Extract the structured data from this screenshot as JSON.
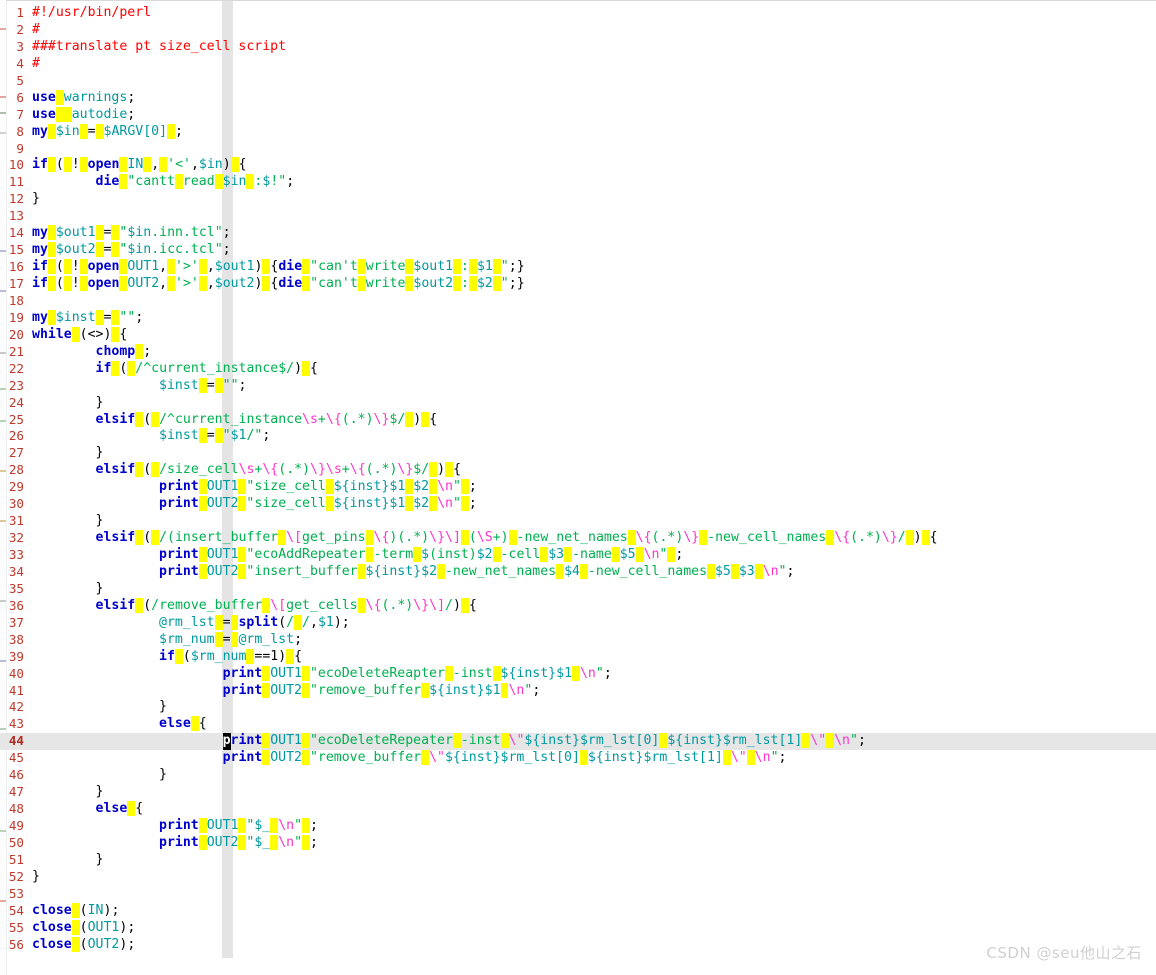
{
  "editor": {
    "language": "perl",
    "current_line": 44,
    "cursor_column": 1,
    "total_lines": 56,
    "colors": {
      "background": "#ffffff",
      "line_number": "#c0392b",
      "keyword": "#0000cc",
      "variable": "#0099a0",
      "string": "#00b050",
      "regex": "#00b050",
      "escape": "#ff33cc",
      "comment": "#ff0000",
      "whitespace_marker": "#ffff00",
      "current_line_highlight": "#e6e6e6",
      "column_guide": "#e4e4e4",
      "cursor": "#000000"
    },
    "lines": [
      {
        "n": 1,
        "text": "#!/usr/bin/perl"
      },
      {
        "n": 2,
        "text": "#"
      },
      {
        "n": 3,
        "text": "###translate pt size_cell script"
      },
      {
        "n": 4,
        "text": "#"
      },
      {
        "n": 5,
        "text": ""
      },
      {
        "n": 6,
        "text": "use warnings;"
      },
      {
        "n": 7,
        "text": "use  autodie;"
      },
      {
        "n": 8,
        "text": "my $in = $ARGV[0] ;"
      },
      {
        "n": 9,
        "text": ""
      },
      {
        "n": 10,
        "text": "if ( ! open IN , '<',$in) {"
      },
      {
        "n": 11,
        "text": "        die \"cantt read $in :$!\";"
      },
      {
        "n": 12,
        "text": "}"
      },
      {
        "n": 13,
        "text": ""
      },
      {
        "n": 14,
        "text": "my $out1 = \"$in.inn.tcl\";"
      },
      {
        "n": 15,
        "text": "my $out2 = \"$in.icc.tcl\";"
      },
      {
        "n": 16,
        "text": "if ( ! open OUT1, '>' ,$out1) {die \"can't write $out1 : $1 \";}"
      },
      {
        "n": 17,
        "text": "if ( ! open OUT2, '>' ,$out2) {die \"can't write $out2 : $2 \";}"
      },
      {
        "n": 18,
        "text": ""
      },
      {
        "n": 19,
        "text": "my $inst = \"\";"
      },
      {
        "n": 20,
        "text": "while (<>) {"
      },
      {
        "n": 21,
        "text": "        chomp ;"
      },
      {
        "n": 22,
        "text": "        if ( /^current_instance$/) {"
      },
      {
        "n": 23,
        "text": "                $inst = \"\";"
      },
      {
        "n": 24,
        "text": "        }"
      },
      {
        "n": 25,
        "text": "        elsif ( /^current_instance\\s+\\{(.*)\\}$/ ) {"
      },
      {
        "n": 26,
        "text": "                $inst = \"$1/\";"
      },
      {
        "n": 27,
        "text": "        }"
      },
      {
        "n": 28,
        "text": "        elsif ( /size_cell\\s+\\{(.*)\\}\\s+\\{(.*)\\}$/ ) {"
      },
      {
        "n": 29,
        "text": "                print OUT1 \"size_cell ${inst}$1 $2 \\n\" ;"
      },
      {
        "n": 30,
        "text": "                print OUT2 \"size_cell ${inst}$1 $2 \\n\" ;"
      },
      {
        "n": 31,
        "text": "        }"
      },
      {
        "n": 32,
        "text": "        elsif ( /(insert_buffer \\[get_pins \\{)(.*)\\}\\] (\\S+) -new_net_names \\{(.*)\\} -new_cell_names \\{(.*)\\}/ ) {"
      },
      {
        "n": 33,
        "text": "                print OUT1 \"ecoAddRepeater -term $(inst)$2 -cell $3 -name $5 \\n\" ;"
      },
      {
        "n": 34,
        "text": "                print OUT2 \"insert_buffer ${inst}$2 -new_net_names $4 -new_cell_names $5 $3 \\n\";"
      },
      {
        "n": 35,
        "text": "        }"
      },
      {
        "n": 36,
        "text": "        elsif (/remove_buffer \\[get_cells \\{(.*)\\}\\]/) {"
      },
      {
        "n": 37,
        "text": "                @rm_lst = split(/ /,$1);"
      },
      {
        "n": 38,
        "text": "                $rm_num = @rm_lst;"
      },
      {
        "n": 39,
        "text": "                if ($rm_num ==1) {"
      },
      {
        "n": 40,
        "text": "                        print OUT1 \"ecoDeleteReapter -inst ${inst}$1 \\n\";"
      },
      {
        "n": 41,
        "text": "                        print OUT2 \"remove_buffer ${inst}$1 \\n\";"
      },
      {
        "n": 42,
        "text": "                }"
      },
      {
        "n": 43,
        "text": "                else {"
      },
      {
        "n": 44,
        "text": "                        print OUT1 \"ecoDeleteRepeater -inst \\\"${inst}$rm_lst[0] ${inst}$rm_lst[1] \\\" \\n\";"
      },
      {
        "n": 45,
        "text": "                        print OUT2 \"remove_buffer \\\"${inst}$rm_lst[0] ${inst}$rm_lst[1] \\\" \\n\";"
      },
      {
        "n": 46,
        "text": "                }"
      },
      {
        "n": 47,
        "text": "        }"
      },
      {
        "n": 48,
        "text": "        else {"
      },
      {
        "n": 49,
        "text": "                print OUT1 \"$_ \\n\" ;"
      },
      {
        "n": 50,
        "text": "                print OUT2 \"$_ \\n\" ;"
      },
      {
        "n": 51,
        "text": "        }"
      },
      {
        "n": 52,
        "text": "}"
      },
      {
        "n": 53,
        "text": ""
      },
      {
        "n": 54,
        "text": "close (IN);"
      },
      {
        "n": 55,
        "text": "close (OUT1);"
      },
      {
        "n": 56,
        "text": "close (OUT2);"
      }
    ]
  },
  "watermark": {
    "text": "CSDN @seu他山之石"
  }
}
